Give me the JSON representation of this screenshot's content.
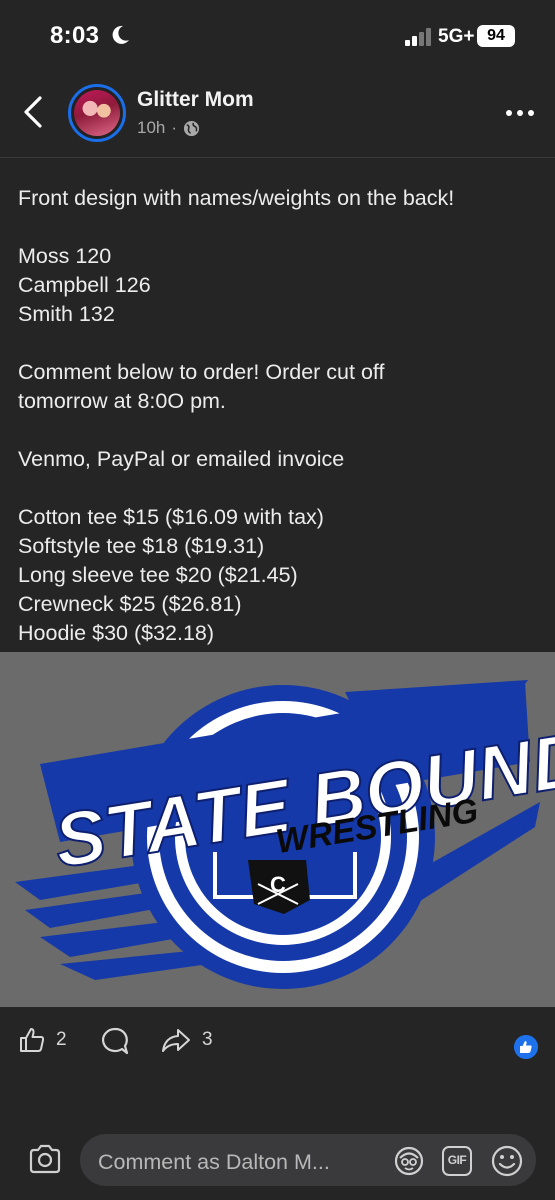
{
  "status": {
    "time": "8:03",
    "network": "5G+",
    "battery": "94"
  },
  "header": {
    "author": "Glitter Mom",
    "timestamp": "10h",
    "separator": "·"
  },
  "post": {
    "line1": "Front design with names/weights on the back!",
    "names": [
      "Moss 120",
      "Campbell 126",
      "Smith 132"
    ],
    "order_line1": "Comment below to order! Order cut off",
    "order_line2": "tomorrow at 8:0O pm.",
    "payment": "Venmo, PayPal or emailed invoice",
    "prices": [
      "Cotton tee $15 ($16.09 with tax)",
      "Softstyle tee $18 ($19.31)",
      "Long sleeve tee $20 ($21.45)",
      "Crewneck $25 ($26.81)",
      "Hoodie $30 ($32.18)"
    ]
  },
  "image": {
    "logo_line1": "STATE BOUND",
    "logo_line2": "WRESTLING",
    "badge_letter": "C"
  },
  "actions": {
    "likes": "2",
    "shares": "3"
  },
  "composer": {
    "placeholder": "Comment as Dalton M...",
    "gif_label": "GIF"
  },
  "colors": {
    "background": "#252526",
    "accent_blue": "#1d72ec",
    "logo_blue": "#1539a8"
  },
  "icons": [
    "moon-icon",
    "signal-icon",
    "back-arrow-icon",
    "globe-icon",
    "more-icon",
    "like-icon",
    "comment-icon",
    "share-icon",
    "like-reaction-icon",
    "camera-icon",
    "avatar-sticker-icon",
    "gif-icon",
    "emoji-icon"
  ]
}
